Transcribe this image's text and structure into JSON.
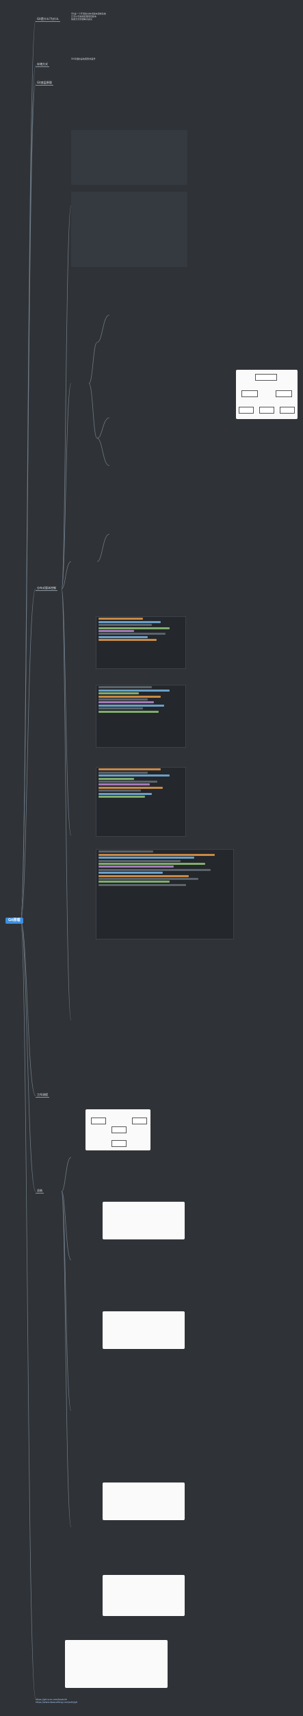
{
  "root": {
    "label": "Git原理"
  },
  "topics": [
    {
      "label": "Git是什么?为什么"
    },
    {
      "label": "存储方式"
    },
    {
      "label": "Git底层原理"
    },
    {
      "label": "分布式版本控制"
    },
    {
      "label": "工作流程"
    },
    {
      "label": "总结"
    }
  ],
  "intro_lines": [
    "Git是一个开源的分布式版本控制系统",
    "它可以高效地管理项目版本",
    "快照方式存储每次提交"
  ],
  "storage": {
    "summary": "Git存储的是快照而非差异"
  },
  "footer_links": [
    "https://git-scm.com/book/zh",
    "https://www.liaoxuefeng.com/wiki/git"
  ]
}
